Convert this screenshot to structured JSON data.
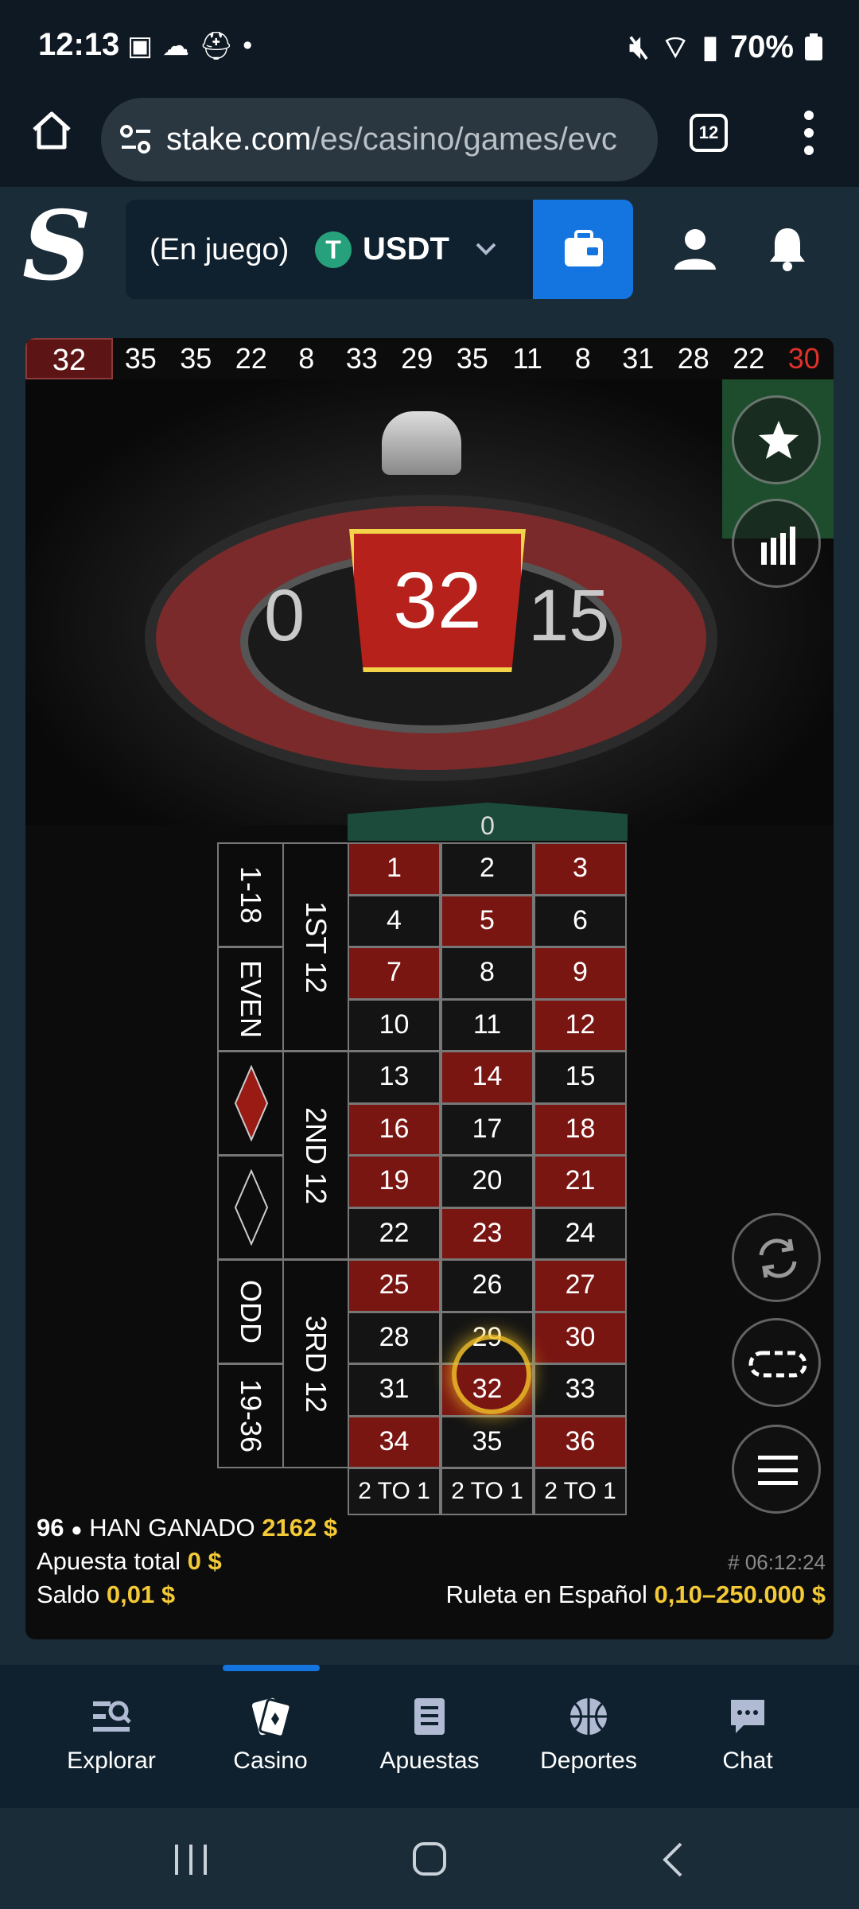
{
  "status_bar": {
    "time": "12:13",
    "battery": "70%"
  },
  "browser": {
    "url_domain": "stake.com",
    "url_path": "/es/casino/games/evc",
    "tab_count": "12"
  },
  "header": {
    "logo": "S",
    "wallet_status": "(En juego)",
    "currency": "USDT",
    "currency_icon": "T"
  },
  "game": {
    "history_first": "32",
    "history": [
      {
        "n": "35",
        "red": false
      },
      {
        "n": "35",
        "red": false
      },
      {
        "n": "22",
        "red": false
      },
      {
        "n": "8",
        "red": false
      },
      {
        "n": "33",
        "red": false
      },
      {
        "n": "29",
        "red": false
      },
      {
        "n": "35",
        "red": false
      },
      {
        "n": "11",
        "red": false
      },
      {
        "n": "8",
        "red": false
      },
      {
        "n": "31",
        "red": false
      },
      {
        "n": "28",
        "red": false
      },
      {
        "n": "22",
        "red": false
      },
      {
        "n": "30",
        "red": true
      }
    ],
    "result": "32",
    "neighbor_left": "0",
    "neighbor_right": "15",
    "zero": "0",
    "dozens": [
      "1ST 12",
      "2ND 12",
      "3RD 12"
    ],
    "outside": {
      "low": "1-18",
      "even": "EVEN",
      "odd": "ODD",
      "high": "19-36"
    },
    "column_bet": "2 TO 1",
    "winners_count": "96",
    "winners_label": "HAN GANADO",
    "winners_amount": "2162 $",
    "total_bet_label": "Apuesta total",
    "total_bet": "0 $",
    "balance_label": "Saldo",
    "balance": "0,01 $",
    "round_id": "# 06:12:24",
    "table_name": "Ruleta en Español",
    "limits": "0,10–250.000 $"
  },
  "bottom_nav": {
    "items": [
      "Explorar",
      "Casino",
      "Apuestas",
      "Deportes",
      "Chat"
    ],
    "active": "Casino"
  },
  "colors": {
    "accent_blue": "#1475e1",
    "gold": "#f3c936",
    "red_cell": "#7a1612",
    "zero_green": "#1c4b3b"
  }
}
